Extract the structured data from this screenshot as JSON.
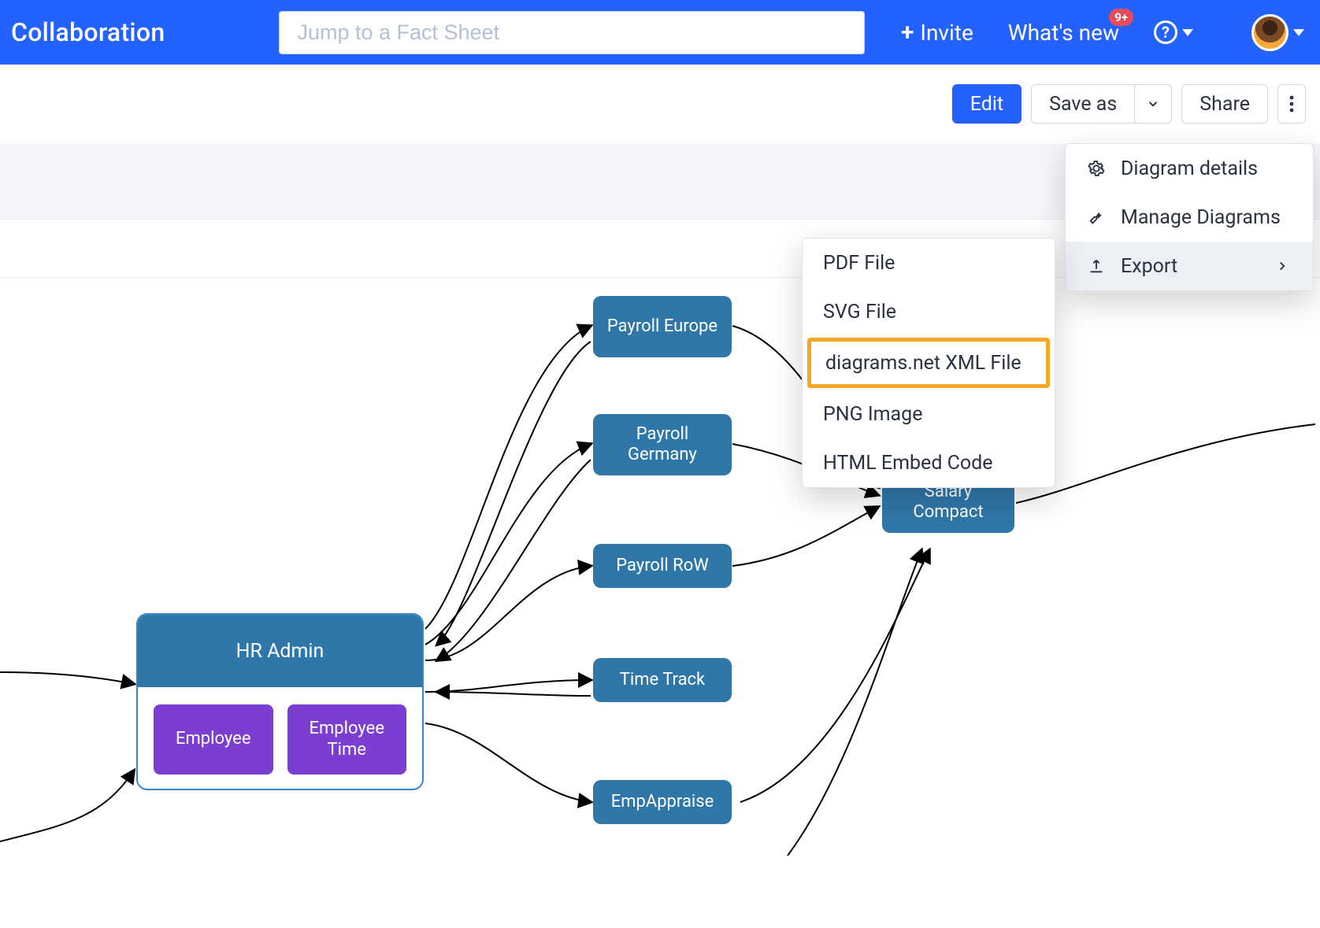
{
  "header": {
    "title": "Collaboration",
    "search_placeholder": "Jump to a Fact Sheet",
    "invite_label": "Invite",
    "whats_new_label": "What's new",
    "whats_new_badge": "9+"
  },
  "actionbar": {
    "edit": "Edit",
    "save_as": "Save as",
    "share": "Share"
  },
  "more_menu": {
    "diagram_details": "Diagram details",
    "manage_diagrams": "Manage Diagrams",
    "export": "Export"
  },
  "export_menu": {
    "pdf": "PDF File",
    "svg": "SVG File",
    "xml": "diagrams.net XML File",
    "png": "PNG Image",
    "html": "HTML Embed Code"
  },
  "diagram": {
    "hr_admin": "HR Admin",
    "employee": "Employee",
    "employee_time": "Employee Time",
    "payroll_europe": "Payroll Europe",
    "payroll_germany": "Payroll Germany",
    "payroll_row": "Payroll RoW",
    "time_track": "Time Track",
    "emp_appraise": "EmpAppraise",
    "salary_compact": "Salary Compact"
  }
}
